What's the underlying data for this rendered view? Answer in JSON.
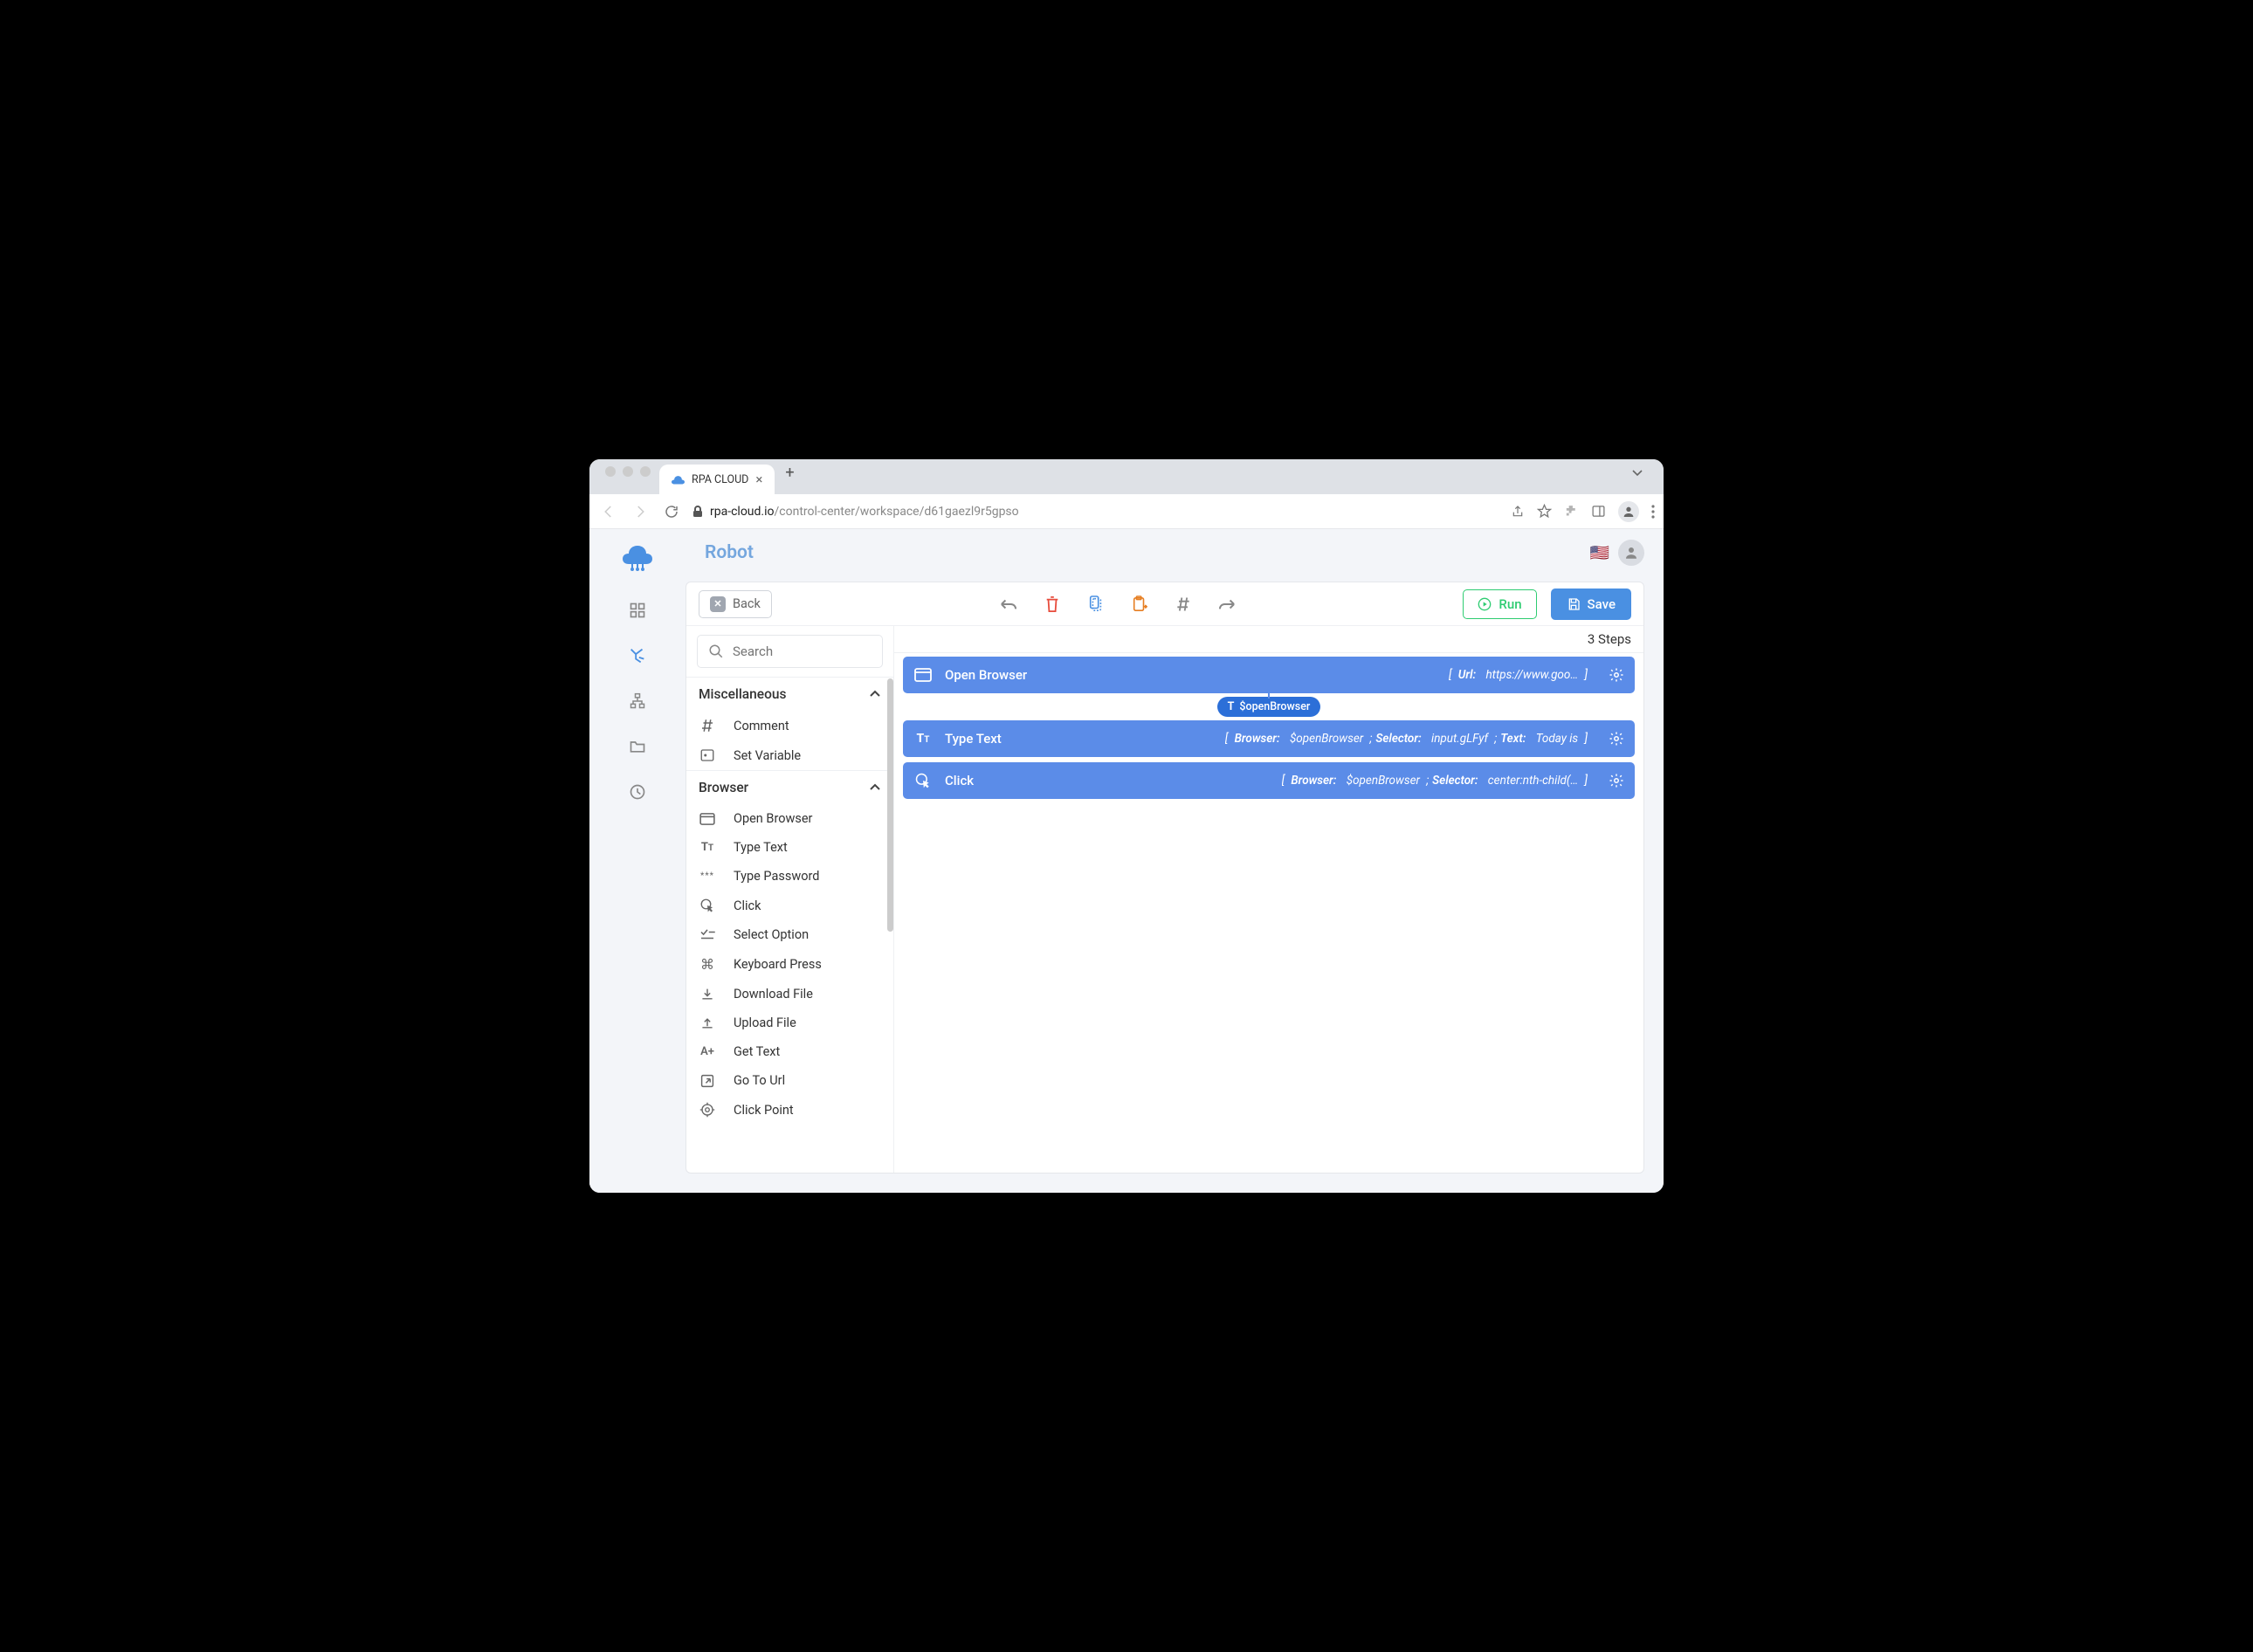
{
  "browser": {
    "tab_title": "RPA CLOUD",
    "url_domain": "rpa-cloud.io",
    "url_path": "/control-center/workspace/d61gaezl9r5gpso"
  },
  "header": {
    "title": "Robot",
    "flag": "🇺🇸"
  },
  "toolbar": {
    "back_label": "Back",
    "run_label": "Run",
    "save_label": "Save"
  },
  "search": {
    "placeholder": "Search"
  },
  "palette": {
    "sections": [
      {
        "title": "Miscellaneous",
        "items": [
          {
            "label": "Comment",
            "icon": "hash"
          },
          {
            "label": "Set Variable",
            "icon": "var"
          }
        ]
      },
      {
        "title": "Browser",
        "items": [
          {
            "label": "Open Browser",
            "icon": "window"
          },
          {
            "label": "Type Text",
            "icon": "tt"
          },
          {
            "label": "Type Password",
            "icon": "asterisk"
          },
          {
            "label": "Click",
            "icon": "click"
          },
          {
            "label": "Select Option",
            "icon": "check"
          },
          {
            "label": "Keyboard Press",
            "icon": "cmd"
          },
          {
            "label": "Download File",
            "icon": "down"
          },
          {
            "label": "Upload File",
            "icon": "up"
          },
          {
            "label": "Get Text",
            "icon": "aplus"
          },
          {
            "label": "Go To Url",
            "icon": "goto"
          },
          {
            "label": "Click Point",
            "icon": "target"
          }
        ]
      }
    ]
  },
  "canvas": {
    "step_count": "3 Steps",
    "connector_chip": "$openBrowser",
    "steps": [
      {
        "name": "Open Browser",
        "icon": "window",
        "params": [
          {
            "key": "Url:",
            "value": "https://www.goo…"
          }
        ]
      },
      {
        "name": "Type Text",
        "icon": "tt",
        "params": [
          {
            "key": "Browser:",
            "value": "$openBrowser"
          },
          {
            "key": "Selector:",
            "value": "input.gLFyf"
          },
          {
            "key": "Text:",
            "value": "Today is"
          }
        ]
      },
      {
        "name": "Click",
        "icon": "click",
        "params": [
          {
            "key": "Browser:",
            "value": "$openBrowser"
          },
          {
            "key": "Selector:",
            "value": "center:nth-child(…"
          }
        ]
      }
    ]
  }
}
